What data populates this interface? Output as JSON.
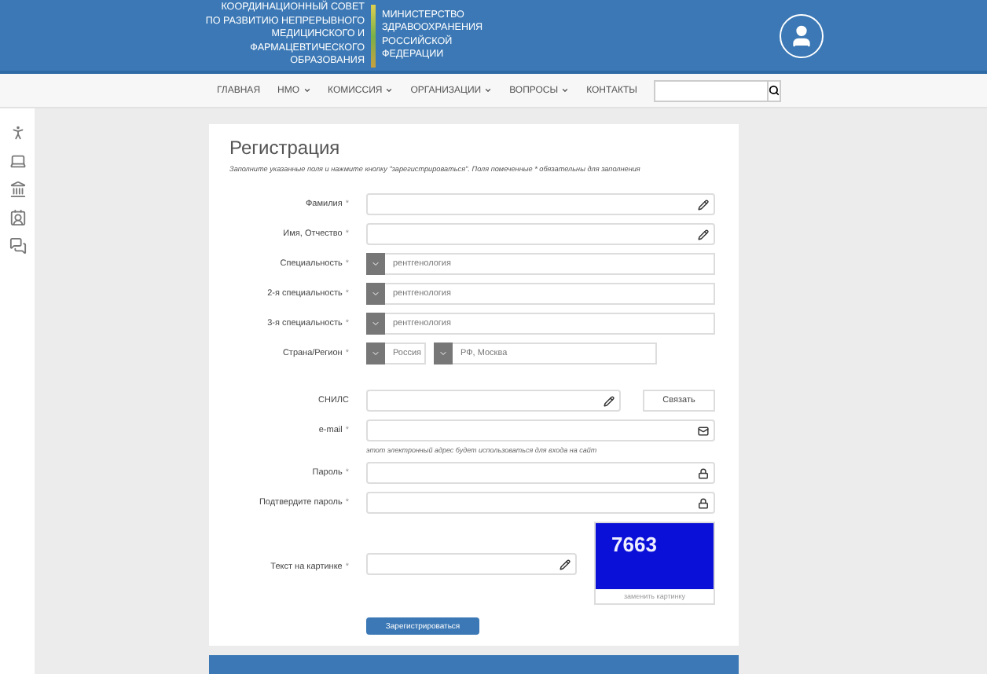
{
  "header": {
    "council_lines": [
      "КООРДИНАЦИОННЫЙ СОВЕТ",
      "ПО РАЗВИТИЮ НЕПРЕРЫВНОГО",
      "МЕДИЦИНСКОГО И",
      "ФАРМАЦЕВТИЧЕСКОГО",
      "ОБРАЗОВАНИЯ"
    ],
    "ministry_lines": [
      "МИНИСТЕРСТВО",
      "ЗДРАВООХРАНЕНИЯ",
      "РОССИЙСКОЙ",
      "ФЕДЕРАЦИИ"
    ]
  },
  "nav": [
    {
      "label": "ГЛАВНАЯ",
      "dropdown": false
    },
    {
      "label": "НМО",
      "dropdown": true
    },
    {
      "label": "КОМИССИЯ",
      "dropdown": true
    },
    {
      "label": "ОРГАНИЗАЦИИ",
      "dropdown": true
    },
    {
      "label": "ВОПРОСЫ",
      "dropdown": true
    },
    {
      "label": "КОНТАКТЫ",
      "dropdown": false
    }
  ],
  "form": {
    "title": "Регистрация",
    "instructions": "Заполните указанные поля и нажмите кнопку \"зарегистрироваться\". Поля помеченные * обязательны для заполнения",
    "personal": [
      {
        "kind": "text",
        "label": "Фамилия",
        "required_mark": "*"
      },
      {
        "kind": "text",
        "label": "Имя, Отчество",
        "required_mark": "*"
      },
      {
        "kind": "select",
        "label": "Специальность",
        "required_mark": "*",
        "values": [
          "рентгенология"
        ]
      },
      {
        "kind": "select",
        "label": "2-я специальность",
        "required_mark": "*",
        "values": [
          "рентгенология"
        ]
      },
      {
        "kind": "select",
        "label": "3-я специальность",
        "required_mark": "*",
        "values": [
          "рентгенология"
        ]
      },
      {
        "kind": "select",
        "label": "Страна/Регион",
        "required_mark": "*",
        "values": [
          "Россия",
          "РФ, Москва"
        ]
      }
    ],
    "account": [
      {
        "kind": "text",
        "label": "СНИЛС",
        "button": "Связать"
      },
      {
        "kind": "email",
        "label": "e-mail",
        "required_mark": "*",
        "hint": "этот электронный адрес будет использоваться для входа на сайт"
      },
      {
        "kind": "password",
        "label": "Пароль",
        "required_mark": "*"
      },
      {
        "kind": "password",
        "label": "Подтвердите пароль",
        "required_mark": "*"
      },
      {
        "kind": "captcha",
        "label": "Текст на картинке",
        "required_mark": "*",
        "code": "7663",
        "refresh": "заменить картинку"
      }
    ],
    "submit": "Зарегистрироваться"
  }
}
